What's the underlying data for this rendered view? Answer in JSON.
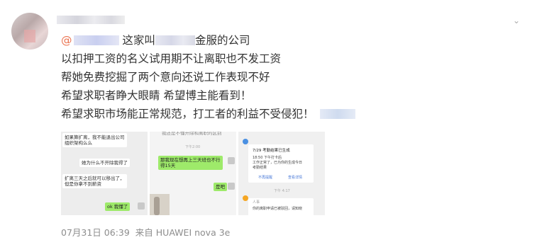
{
  "post": {
    "lines": [
      {
        "prefix": "@",
        "after": " 这家叫",
        "after2": "金服的公司"
      },
      "以扣押工资的名义试用期不让离职也不发工资",
      "帮她免费挖掘了两个意向还说工作表现不好",
      "希望求职者睁大眼睛 希望博主能看到！",
      "希望求职市场能正常规范，打工者的利益不受侵犯！"
    ]
  },
  "images": {
    "chat1": {
      "msg1": "如果算扩离，我不能退出公司",
      "msg1b": "组织架构么么",
      "msg2": "她为什么不开除我得了",
      "msg3": "扩离三天之后就可以移出了，",
      "msg3b": "但是你拿不到薪资",
      "msg4": "ok 我懂了"
    },
    "chat2": {
      "top": "我还是不懂开除和离职的区别",
      "time": "下午2:00",
      "msg1": "那我现在想再上三天班也不行",
      "msg1b": "得15天",
      "msg2": "是吧"
    },
    "chat3": {
      "title": "7/29 考勤结果已生成",
      "l1": "18:50 下午打卡后",
      "l2": "工作正常了，已为你的生成今日",
      "l3": "考勤结果",
      "btn1": "不再提醒",
      "btn2": "查看详情",
      "time": "下午 4:17",
      "dept": "人事",
      "l4": "你的离职申请已被驳回，请知晓"
    }
  },
  "footer": {
    "date": "07月31日 06:39",
    "from": "来自 HUAWEI nova 3e"
  },
  "colors": {
    "mention": "#eb7350",
    "footer": "#8d8d8d"
  }
}
